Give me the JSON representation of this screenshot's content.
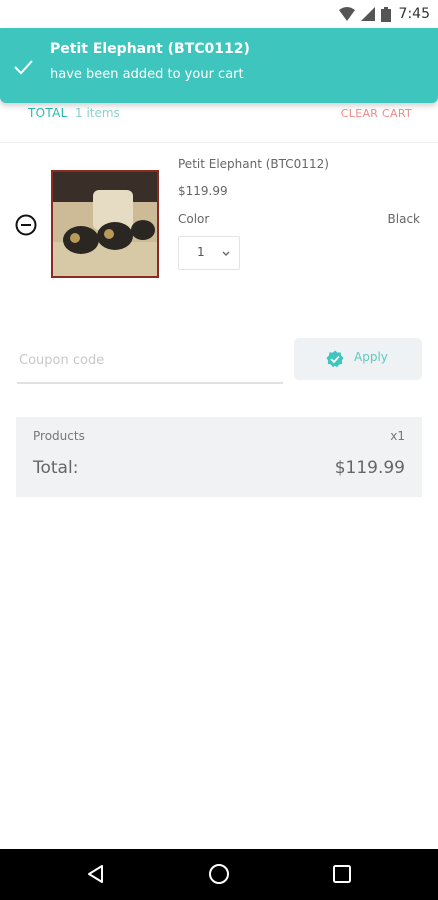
{
  "status_bar": {
    "time": "7:45"
  },
  "toast": {
    "title": "Petit Elephant (BTC0112)",
    "message": "have been added to your cart"
  },
  "cart": {
    "total_label": "TOTAL",
    "items_count": "1 items",
    "clear_label": "CLEAR CART"
  },
  "item": {
    "name": "Petit Elephant (BTC0112)",
    "price": "$119.99",
    "color_label": "Color",
    "color_value": "Black",
    "quantity": "1"
  },
  "coupon": {
    "placeholder": "Coupon code",
    "apply_label": "Apply"
  },
  "summary": {
    "products_label": "Products",
    "products_qty": "x1",
    "total_label": "Total:",
    "total_value": "$119.99"
  },
  "colors": {
    "accent": "#3ec6be",
    "clear": "#f08a8a",
    "summary_bg": "#f0f2f4"
  }
}
